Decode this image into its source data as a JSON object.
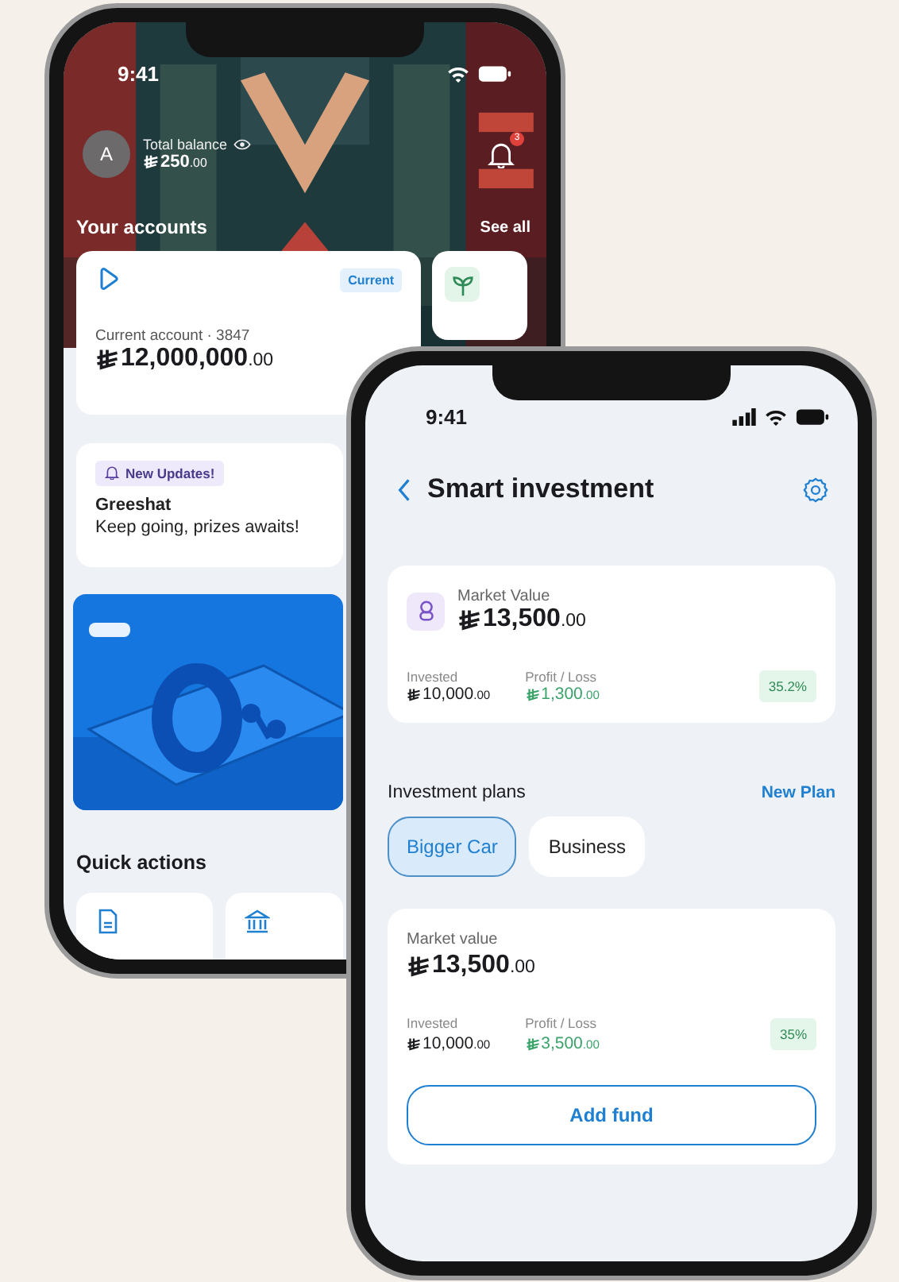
{
  "back_phone": {
    "status_time": "9:41",
    "profile": {
      "avatar": "A",
      "label": "Total balance",
      "balance": {
        "whole": "250",
        "fraction": ".00"
      }
    },
    "notifications": {
      "count": "3"
    },
    "accounts": {
      "title": "Your accounts",
      "link": "See all",
      "cards": [
        {
          "kind": "current",
          "badge": "Current",
          "name": "Current account · 3847",
          "balance": {
            "whole": "12,000,000",
            "fraction": ".00"
          }
        },
        {
          "kind": "plant"
        }
      ]
    },
    "update": {
      "tag": "New Updates!",
      "title": "Greeshat",
      "text": "Keep going, prizes awaits!"
    },
    "quick_actions": {
      "title": "Quick actions",
      "items": [
        {
          "kind": "document"
        },
        {
          "kind": "bank"
        }
      ]
    }
  },
  "front_phone": {
    "status_time": "9:41",
    "title": "Smart investment",
    "summary": {
      "label": "Market Value",
      "value": {
        "whole": "13,500",
        "fraction": ".00"
      },
      "invested_label": "Invested",
      "invested": {
        "whole": "10,000",
        "fraction": ".00"
      },
      "profit_label": "Profit / Loss",
      "profit": {
        "whole": "1,300",
        "fraction": ".00"
      },
      "return": "35.2%"
    },
    "plans": {
      "title": "Investment plans",
      "link": "New Plan",
      "tabs": [
        {
          "label": "Bigger Car",
          "selected": true
        },
        {
          "label": "Business",
          "selected": false
        }
      ],
      "card": {
        "label": "Market value",
        "value": {
          "whole": "13,500",
          "fraction": ".00"
        },
        "invested_label": "Invested",
        "invested": {
          "whole": "10,000",
          "fraction": ".00"
        },
        "profit_label": "Profit / Loss",
        "profit": {
          "whole": "3,500",
          "fraction": ".00"
        },
        "return": "35%",
        "button": "Add fund"
      }
    }
  }
}
